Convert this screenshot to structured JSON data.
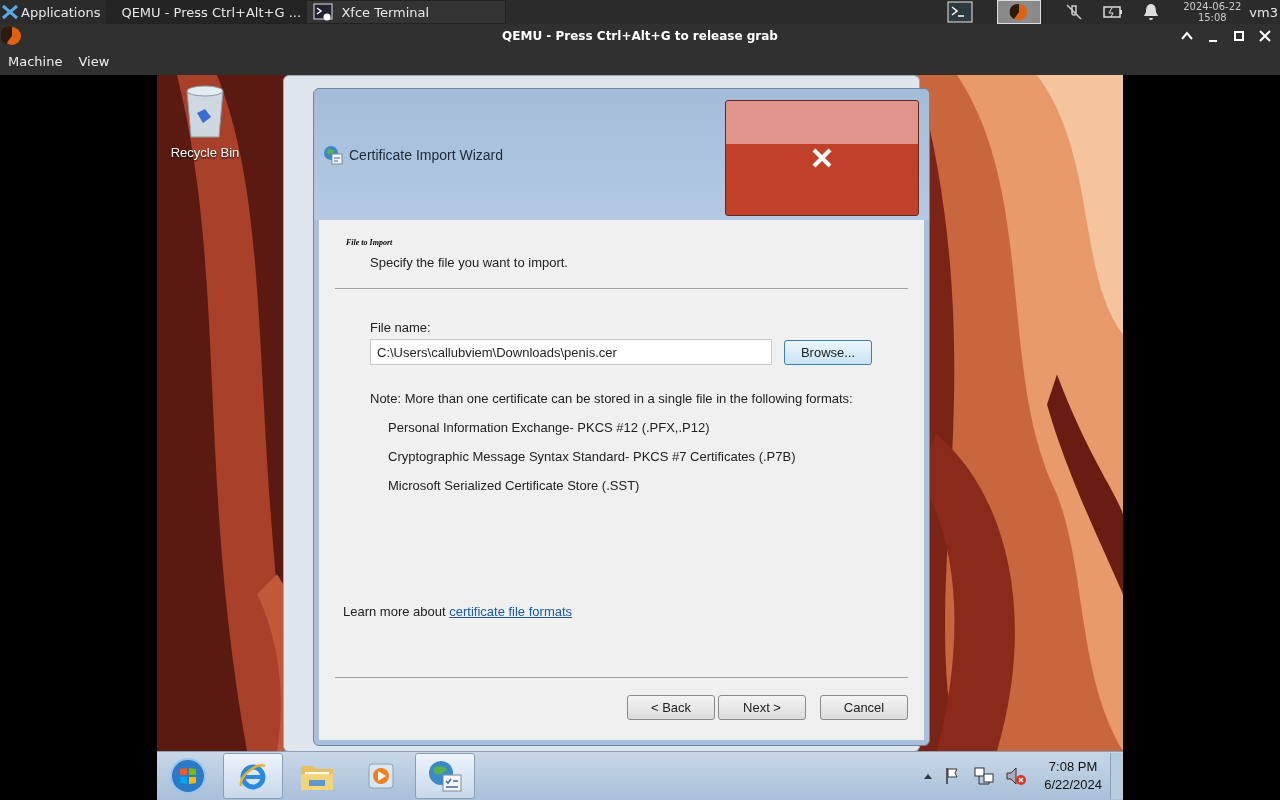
{
  "panel": {
    "apps_menu": "Applications",
    "tasks": [
      {
        "label": "QEMU - Press Ctrl+Alt+G ...",
        "kind": "qemu",
        "selected": true
      },
      {
        "label": "Xfce Terminal",
        "kind": "terminal",
        "selected": false
      }
    ],
    "clock": {
      "date": "2024-06-22",
      "time": "15:08"
    },
    "user": "vm3"
  },
  "window": {
    "title": "QEMU - Press Ctrl+Alt+G to release grab",
    "menu": [
      "Machine",
      "View"
    ]
  },
  "desktop": {
    "icons": [
      {
        "label": "Recycle Bin"
      }
    ]
  },
  "wizard": {
    "title": "Certificate Import Wizard",
    "heading": "File to Import",
    "subheading": "Specify the file you want to import.",
    "file_label": "File name:",
    "file_value": "C:\\Users\\callubviem\\Downloads\\penis.cer",
    "browse": "Browse...",
    "note": "Note:  More than one certificate can be stored in a single file in the following formats:",
    "formats": [
      "Personal Information Exchange- PKCS #12 (.PFX,.P12)",
      "Cryptographic Message Syntax Standard- PKCS #7 Certificates (.P7B)",
      "Microsoft Serialized Certificate Store (.SST)"
    ],
    "learn_more": "Learn more about",
    "link": "certificate file formats",
    "buttons": [
      {
        "label": "< Back",
        "kind": "back"
      },
      {
        "label": "Next >",
        "kind": "next"
      },
      {
        "label": "Cancel",
        "kind": "cancel"
      }
    ]
  },
  "taskbar": {
    "items": [
      {
        "kind": "ie",
        "running": true
      },
      {
        "kind": "folder",
        "running": false
      },
      {
        "kind": "media",
        "running": false
      },
      {
        "kind": "wizard",
        "running": true
      }
    ],
    "clock": {
      "time": "7:08 PM",
      "date": "6/22/2024"
    }
  }
}
